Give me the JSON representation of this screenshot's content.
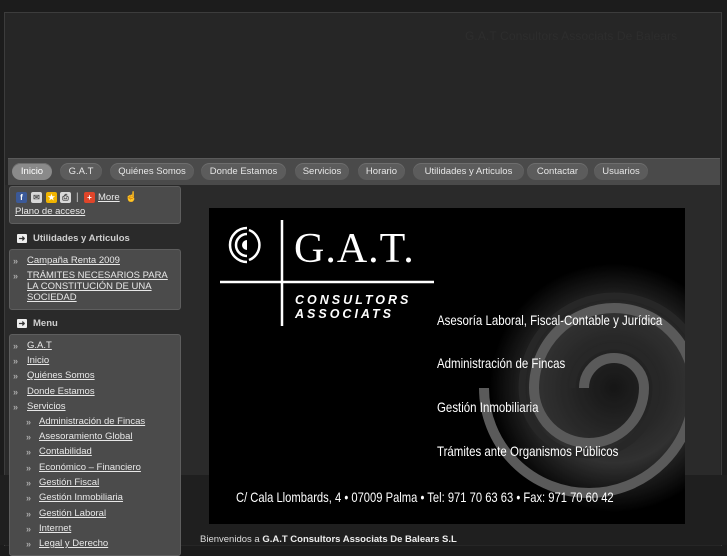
{
  "header": {
    "site_title": "G.A.T Consultors Associats De Balears"
  },
  "nav": {
    "items": [
      {
        "label": "Inicio",
        "active": true
      },
      {
        "label": "G.A.T"
      },
      {
        "label": "Quiénes Somos"
      },
      {
        "label": "Donde Estamos"
      },
      {
        "label": "Servicios"
      },
      {
        "label": "Horario"
      },
      {
        "label": "Utilidades y Articulos"
      },
      {
        "label": "Contactar"
      },
      {
        "label": "Usuarios"
      }
    ]
  },
  "share": {
    "separator": "|",
    "more_label": "More",
    "access_link": "Plano de acceso"
  },
  "utilities": {
    "heading": "Utilidades y Articulos",
    "items": [
      "Campaña Renta 2009",
      "TRÁMITES NECESARIOS PARA LA CONSTITUCIÓN DE UNA SOCIEDAD"
    ]
  },
  "menu": {
    "heading": "Menu",
    "items": [
      "G.A.T",
      "Inicio",
      "Quiénes Somos",
      "Donde Estamos",
      "Servicios"
    ],
    "sub_items": [
      "Administración de Fincas",
      "Asesoramiento Global",
      "Contabilidad",
      "Económico – Financiero",
      "Gestión Fiscal",
      "Gestión Inmobiliaria",
      "Gestión Laboral",
      "Internet",
      "Legal y Derecho"
    ]
  },
  "banner": {
    "logo_text": "G.A.T.",
    "logo_sub1": "CONSULTORS",
    "logo_sub2": "ASSOCIATS",
    "services": [
      "Asesoría Laboral, Fiscal-Contable y Jurídica",
      "Administración de Fincas",
      "Gestión Inmobiliaria",
      "Trámites ante Organismos Públicos"
    ],
    "address": "C/ Cala Llombards, 4 • 07009 Palma • Tel: 971 70 63 63 • Fax: 971 70 60 42"
  },
  "welcome": {
    "prefix": "Bienvenidos a",
    "company": "G.A.T Consultors Associats De Balears S.L"
  }
}
